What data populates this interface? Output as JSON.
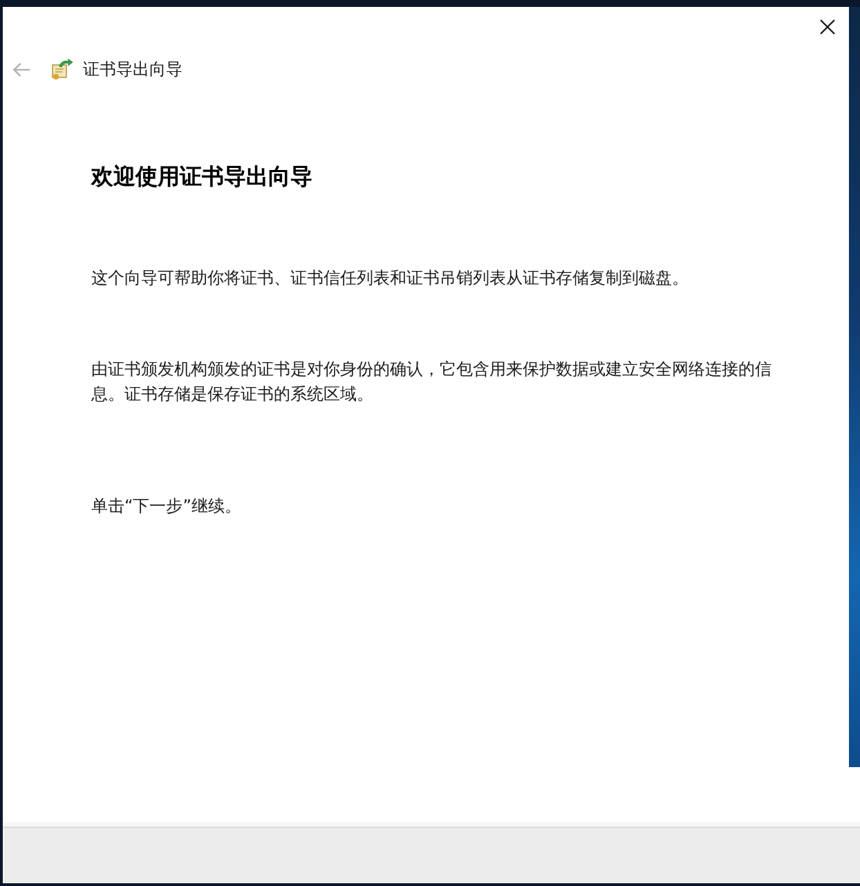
{
  "title_bar": {
    "back_button": {
      "disabled": true
    },
    "title": "证书导出向导"
  },
  "page": {
    "heading": "欢迎使用证书导出向导",
    "paragraphs": [
      "这个向导可帮助你将证书、证书信任列表和证书吊销列表从证书存储复制到磁盘。",
      "由证书颁发机构颁发的证书是对你身份的确认，它包含用来保护数据或建立安全网络连接的信息。证书存储是保存证书的系统区域。",
      "单击“下一步”继续。"
    ]
  }
}
